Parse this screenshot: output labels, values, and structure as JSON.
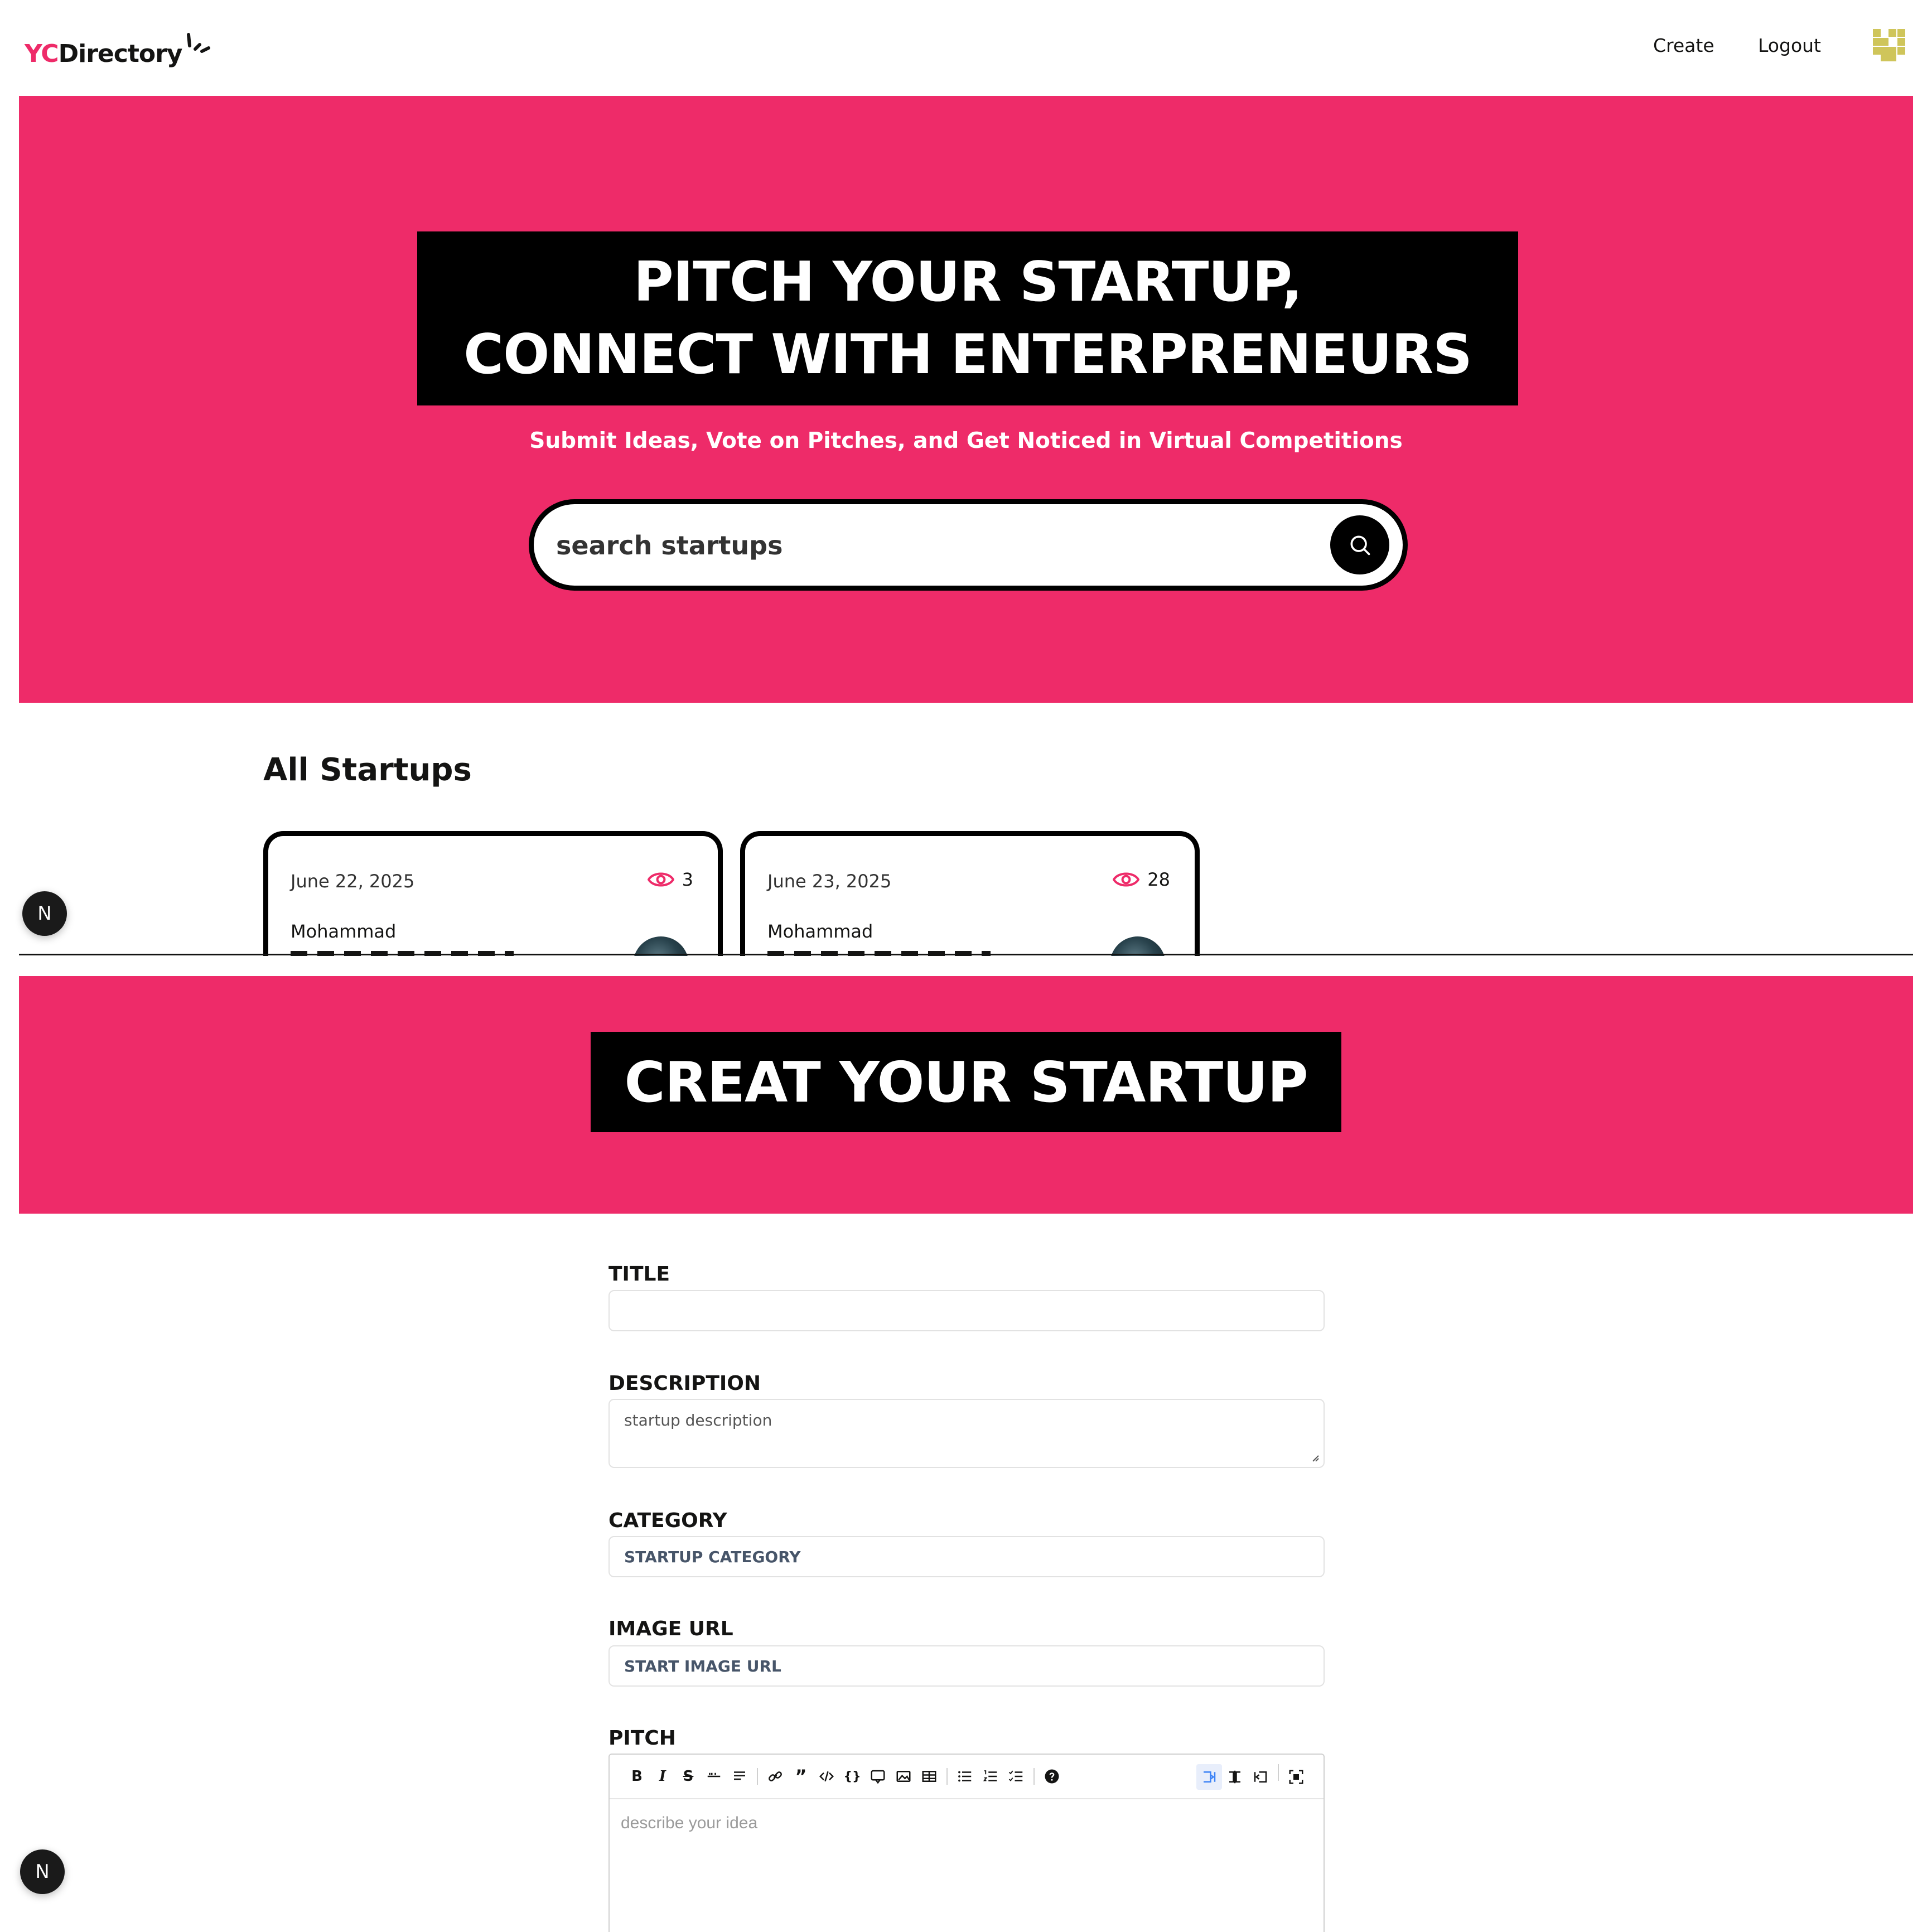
{
  "navbar": {
    "logo_yc": "YC",
    "logo_directory": "Directory",
    "links": {
      "create": "Create",
      "logout": "Logout"
    }
  },
  "hero": {
    "heading_line1": "PITCH YOUR STARTUP,",
    "heading_line2": "CONNECT WITH ENTERPRENEURS",
    "subheading": "Submit Ideas, Vote on Pitches, and Get Noticed in Virtual Competitions",
    "search_placeholder": "search startups"
  },
  "startups": {
    "section_title": "All Startups",
    "cards": [
      {
        "date": "June 22, 2025",
        "views": "3",
        "author": "Mohammad"
      },
      {
        "date": "June 23, 2025",
        "views": "28",
        "author": "Mohammad"
      }
    ]
  },
  "create": {
    "heading": "CREAT YOUR STARTUP",
    "form": {
      "title_label": "TITLE",
      "title_value": "",
      "description_label": "DESCRIPTION",
      "description_placeholder": "startup description",
      "category_label": "CATEGORY",
      "category_placeholder": "STARTUP CATEGORY",
      "image_label": "IMAGE URL",
      "image_placeholder": "START IMAGE URL",
      "pitch_label": "PITCH",
      "pitch_placeholder": "describe your idea"
    }
  },
  "badge": {
    "letter": "N"
  },
  "colors": {
    "primary": "#EE2B69",
    "black": "#000000",
    "text": "#141413"
  }
}
